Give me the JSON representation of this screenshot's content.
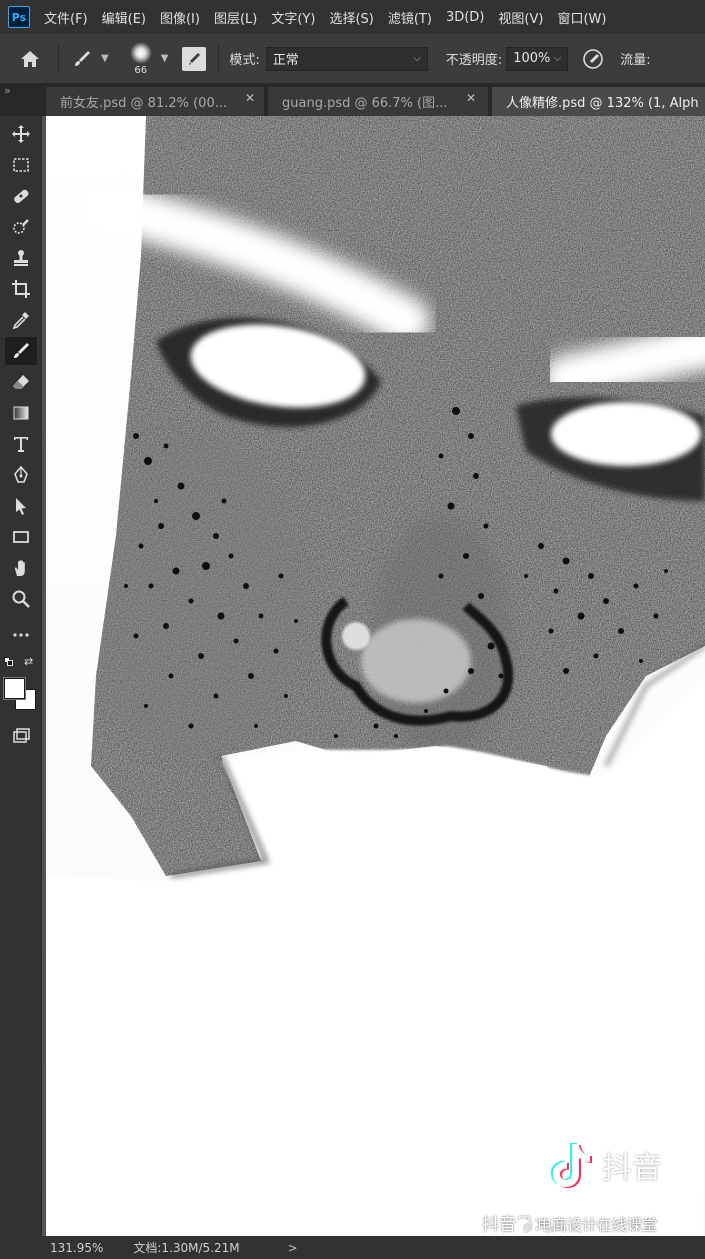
{
  "app": {
    "logo": "Ps"
  },
  "menu": [
    "文件(F)",
    "编辑(E)",
    "图像(I)",
    "图层(L)",
    "文字(Y)",
    "选择(S)",
    "滤镜(T)",
    "3D(D)",
    "视图(V)",
    "窗口(W)"
  ],
  "options": {
    "brush_size": "66",
    "mode_label": "模式:",
    "mode_value": "正常",
    "opacity_label": "不透明度:",
    "opacity_value": "100%",
    "flow_label": "流量:"
  },
  "tabs": [
    {
      "label": "前女友.psd @ 81.2% (00...",
      "active": false
    },
    {
      "label": "guang.psd @ 66.7% (图...",
      "active": false
    },
    {
      "label": "人像精修.psd @ 132% (1, Alph",
      "active": true
    }
  ],
  "tools": [
    "move-tool-icon",
    "marquee-tool-icon",
    "healing-brush-icon",
    "quick-select-icon",
    "clone-stamp-icon",
    "crop-icon",
    "eyedropper-icon",
    "brush-icon",
    "eraser-icon",
    "gradient-icon",
    "type-tool-icon",
    "pen-tool-icon",
    "path-select-icon",
    "rectangle-icon",
    "hand-tool-icon",
    "zoom-icon",
    "more-tools-icon"
  ],
  "status": {
    "zoom": "131.95%",
    "doc": "文档:1.30M/5.21M",
    "arrow": ">"
  },
  "watermark": {
    "platform": "抖音",
    "douyin_id": "抖音号：…",
    "wechat": "电商设计在线课堂"
  },
  "colors": {
    "foreground": "#ffffff",
    "background": "#ffffff",
    "accent": "#31a8ff"
  }
}
